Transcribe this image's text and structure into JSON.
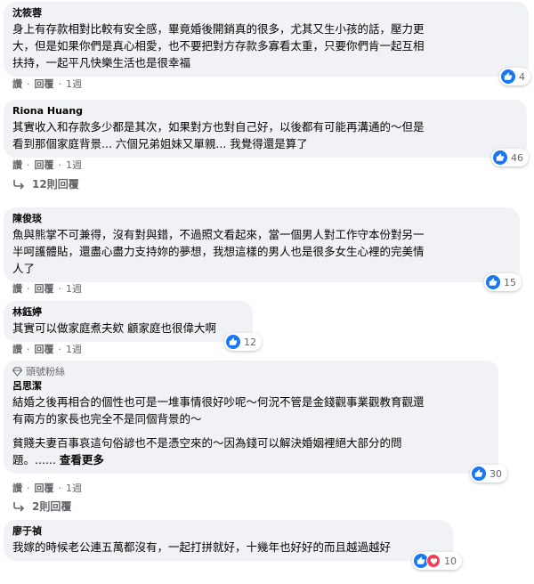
{
  "comments": [
    {
      "author": "沈筱蓉",
      "lines": [
        "身上有存款相對比較有安全感，畢竟婚後開銷真的很多，尤其又生小孩的話，壓力更",
        "大，但是如果你們是真心相愛，也不要把對方存款多寡看太重，只要你們肯一起互相",
        "扶持，一起平凡快樂生活也是很幸福"
      ],
      "reaction_count": "4",
      "like": "讚",
      "reply": "回覆",
      "time": "1週"
    },
    {
      "author": "Riona Huang",
      "lines": [
        "其實收入和存款多少都是其次，如果對方也對自己好，以後都有可能再溝通的～但是",
        "看到那個家庭背景... 六個兄弟姐妹又單親... 我覺得還是算了"
      ],
      "reaction_count": "46",
      "like": "讚",
      "reply": "回覆",
      "time": "1週",
      "replies_label": "12則回覆"
    },
    {
      "author": "陳俊琰",
      "lines": [
        "魚與熊掌不可兼得，沒有對與錯，不過照文看起來，當一個男人對工作守本份對另一",
        "半呵護體貼，還盡心盡力支持妳的夢想，我想這樣的男人也是很多女生心裡的完美情",
        "人了"
      ],
      "reaction_count": "15",
      "like": "讚",
      "reply": "回覆",
      "time": "1週"
    },
    {
      "author": "林鈺婷",
      "lines": [
        "其實可以做家庭煮夫欸 顧家庭也很偉大啊"
      ],
      "reaction_count": "12",
      "like": "讚",
      "reply": "回覆",
      "time": "1週"
    },
    {
      "badge": "頭號粉絲",
      "author": "呂思潔",
      "lines": [
        "結婚之後再相合的個性也可是一堆事情很好吵呢～何況不管是金錢觀事業觀教育觀還",
        "有兩方的家長也完全不是同個背景的～"
      ],
      "lines2": [
        "貧賤夫妻百事哀這句俗諺也不是憑空來的～因為錢可以解決婚姻裡絕大部分的問",
        "題。......"
      ],
      "see_more": "查看更多",
      "reaction_count": "30",
      "like": "讚",
      "reply": "回覆",
      "time": "1週",
      "replies_label": "2則回覆"
    },
    {
      "author": "廖于禎",
      "lines": [
        "我嫁的時候老公連五萬都沒有，一起打拼就好，十幾年也好好的而且越過越好"
      ],
      "reaction_count": "10"
    }
  ],
  "colors": {
    "bubble": "#f0f2f5",
    "like_blue": "#1877f2",
    "love_red": "#f33e58",
    "meta_gray": "#65676b"
  }
}
